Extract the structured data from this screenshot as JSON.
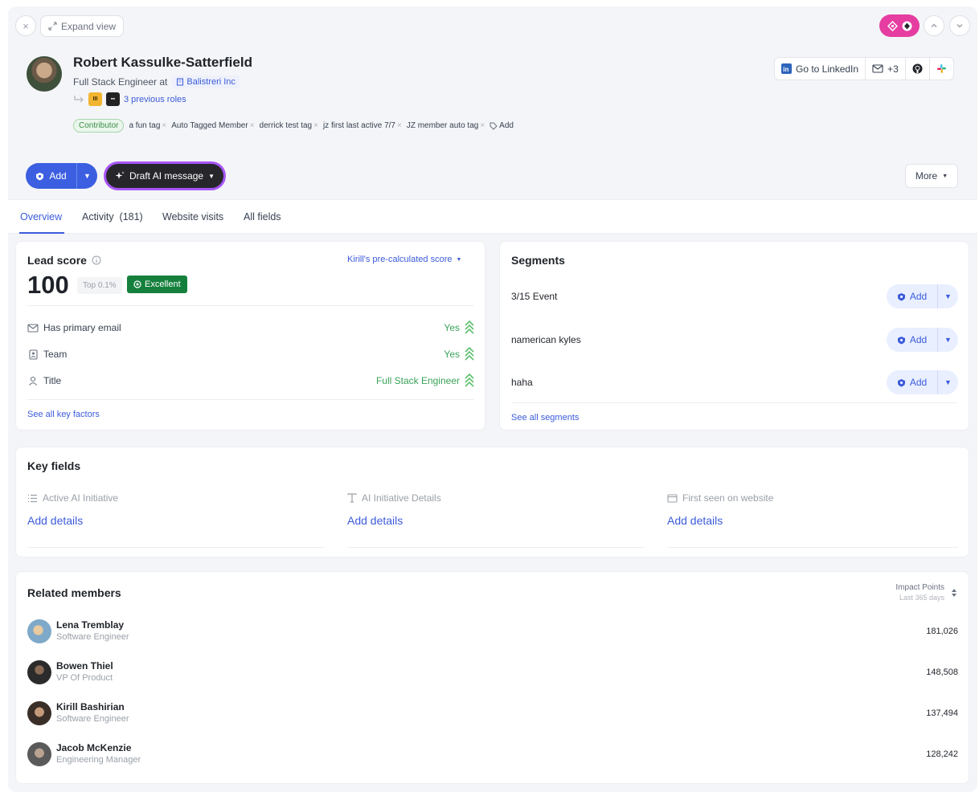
{
  "topbar": {
    "close_icon": "×",
    "expand_label": "Expand view"
  },
  "profile": {
    "name": "Robert Kassulke-Satterfield",
    "role_prefix": "Full Stack Engineer at",
    "company": "Balistreri Inc",
    "previous_roles": "3 previous roles",
    "tags": [
      {
        "label": "Contributor"
      },
      {
        "label": "a fun tag"
      },
      {
        "label": "Auto Tagged Member"
      },
      {
        "label": "derrick test tag"
      },
      {
        "label": "jz first last active 7/7"
      },
      {
        "label": "JZ member auto tag"
      }
    ],
    "add_tag_label": "Add"
  },
  "header_actions": {
    "linkedin": "Go to LinkedIn",
    "email_count": "+3"
  },
  "action_bar": {
    "add_label": "Add",
    "draft_label": "Draft AI message",
    "more_label": "More"
  },
  "tabs": [
    {
      "label": "Overview"
    },
    {
      "label": "Activity  (181)"
    },
    {
      "label": "Website visits"
    },
    {
      "label": "All fields"
    }
  ],
  "lead_score": {
    "title": "Lead score",
    "selector": "Kirill's pre-calculated score",
    "score": "100",
    "percentile": "Top 0.1%",
    "rating": "Excellent",
    "factors": [
      {
        "label": "Has primary email",
        "value": "Yes",
        "icon": "email-icon"
      },
      {
        "label": "Team",
        "value": "Yes",
        "icon": "team-icon"
      },
      {
        "label": "Title",
        "value": "Full Stack Engineer",
        "icon": "person-icon"
      }
    ],
    "see_all": "See all key factors"
  },
  "segments": {
    "title": "Segments",
    "items": [
      {
        "label": "3/15 Event"
      },
      {
        "label": "namerican kyles"
      },
      {
        "label": "haha"
      }
    ],
    "add_label": "Add",
    "see_all": "See all segments"
  },
  "key_fields": {
    "title": "Key fields",
    "fields": [
      {
        "label": "Active AI Initiative",
        "action": "Add details"
      },
      {
        "label": "AI Initiative Details",
        "action": "Add details"
      },
      {
        "label": "First seen on website",
        "action": "Add details"
      }
    ]
  },
  "related_members": {
    "title": "Related members",
    "sort_label": "Impact Points",
    "sort_sub": "Last 365 days",
    "members": [
      {
        "name": "Lena Tremblay",
        "title": "Software Engineer",
        "points": "181,026"
      },
      {
        "name": "Bowen Thiel",
        "title": "VP Of Product",
        "points": "148,508"
      },
      {
        "name": "Kirill Bashirian",
        "title": "Software Engineer",
        "points": "137,494"
      },
      {
        "name": "Jacob McKenzie",
        "title": "Engineering Manager",
        "points": "128,242"
      }
    ]
  },
  "colors": {
    "accent": "#3b5bdb",
    "brand_pink": "#e63da1",
    "success": "#15803d"
  }
}
